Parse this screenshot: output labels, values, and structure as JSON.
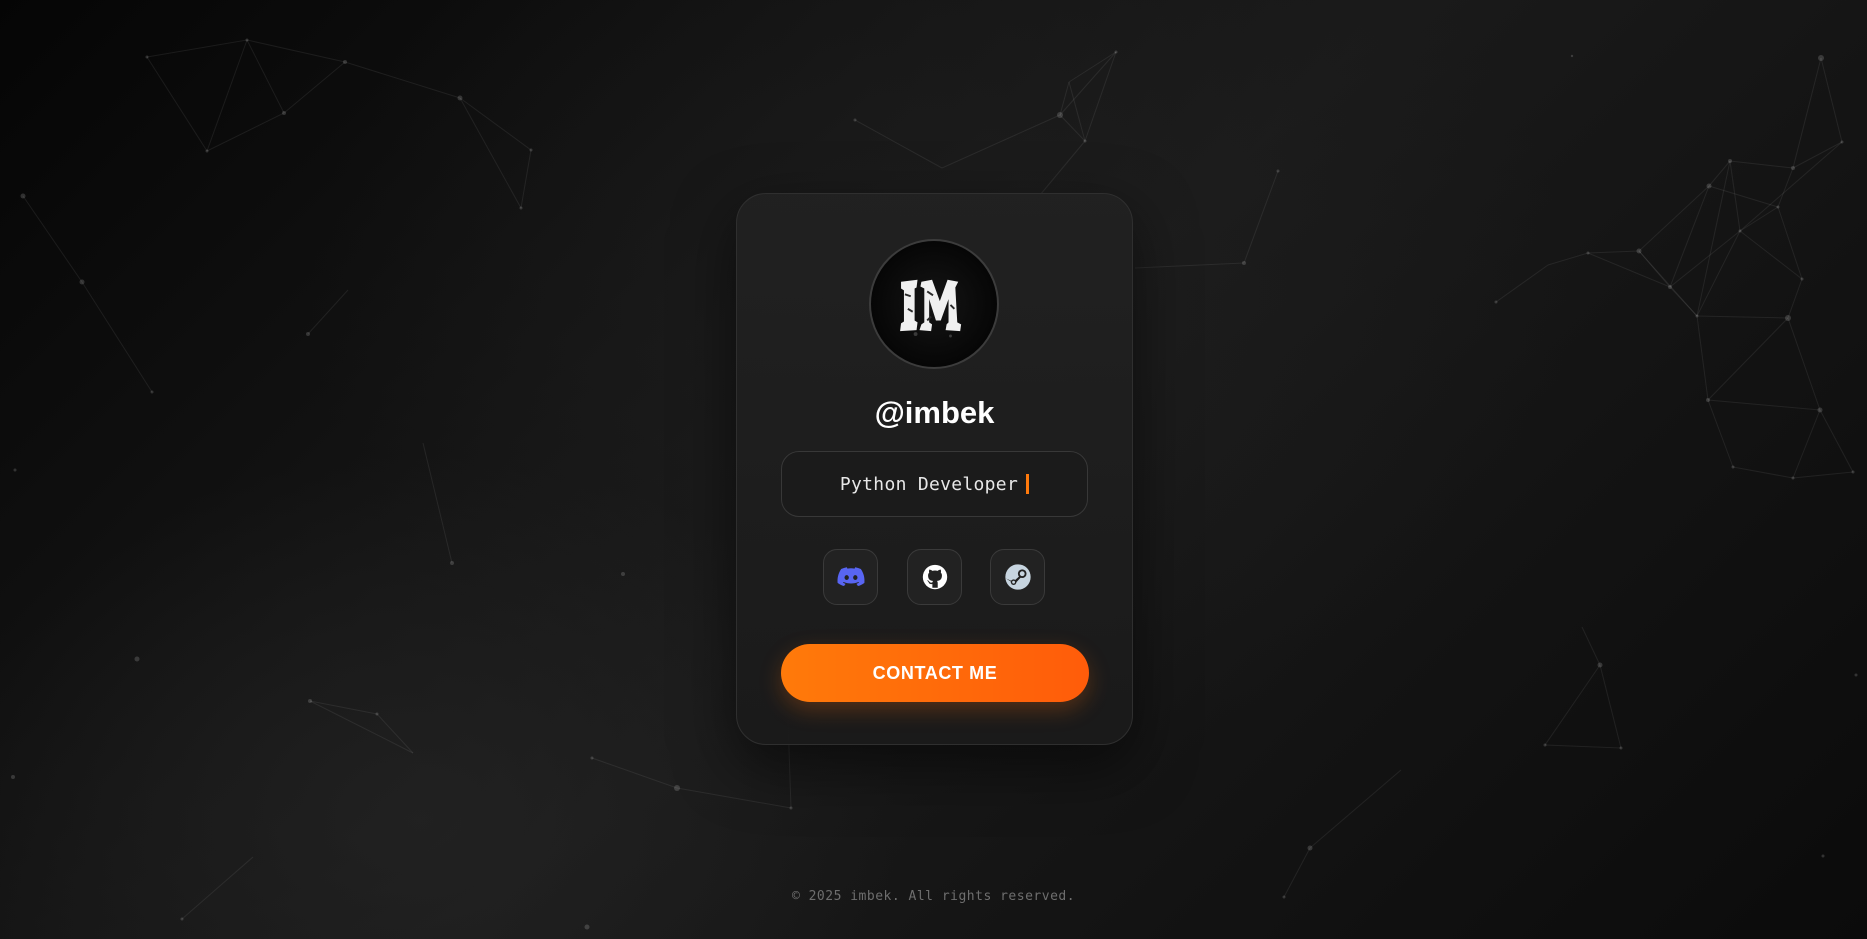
{
  "profile": {
    "username": "@imbek",
    "role": "Python Developer",
    "avatar_icon": "im-monogram-logo"
  },
  "socials": [
    {
      "name": "discord-icon",
      "color": "#5865F2"
    },
    {
      "name": "github-icon",
      "color": "#FFFFFF"
    },
    {
      "name": "steam-icon",
      "color": "#C7D5E0"
    }
  ],
  "contact": {
    "label": "CONTACT ME"
  },
  "footer": {
    "copyright": "© 2025 imbek. All rights reserved."
  },
  "colors": {
    "accent": "#FF6A0A",
    "background": "#121212",
    "card": "#1E1E1E"
  }
}
